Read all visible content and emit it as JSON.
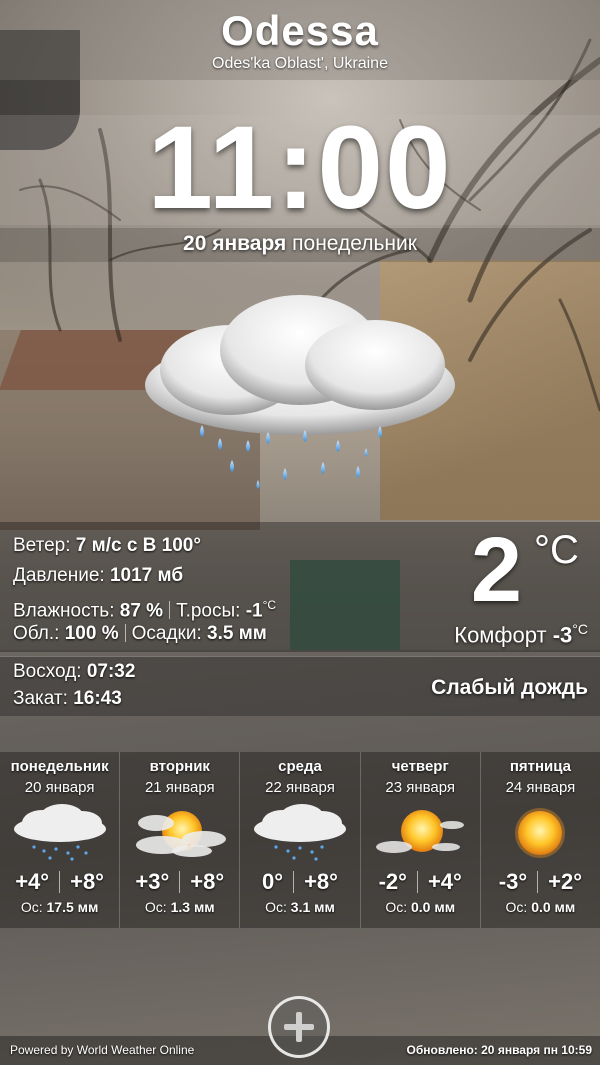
{
  "location": {
    "city": "Odessa",
    "region": "Odes'ka Oblast', Ukraine"
  },
  "clock": {
    "time": "11:00",
    "date_bold": "20 января",
    "weekday": "понедельник"
  },
  "current": {
    "icon": "rain-cloud-icon",
    "wind_label": "Ветер:",
    "wind_value": "7 м/с с В 100°",
    "pressure_label": "Давление:",
    "pressure_value": "1017 мб",
    "humidity_label": "Влажность:",
    "humidity_value": "87 %",
    "dewpoint_label": "Т.росы:",
    "dewpoint_value": "-1",
    "dewpoint_unit": "°C",
    "clouds_label": "Обл.:",
    "clouds_value": "100 %",
    "precip_label": "Осадки:",
    "precip_value": "3.5 мм",
    "temperature": "2",
    "temperature_unit": "°C",
    "feels_label": "Комфорт",
    "feels_value": "-3",
    "feels_unit": "°C",
    "sunrise_label": "Восход:",
    "sunrise_value": "07:32",
    "sunset_label": "Закат:",
    "sunset_value": "16:43",
    "condition": "Слабый дождь"
  },
  "forecast": [
    {
      "day": "понедельник",
      "date": "20 января",
      "icon": "rain-cloud-icon",
      "low": "+4°",
      "high": "+8°",
      "precip_label": "Ос:",
      "precip": "17.5 мм"
    },
    {
      "day": "вторник",
      "date": "21 января",
      "icon": "partly-cloudy-icon",
      "low": "+3°",
      "high": "+8°",
      "precip_label": "Ос:",
      "precip": "1.3 мм"
    },
    {
      "day": "среда",
      "date": "22 января",
      "icon": "rain-cloud-icon",
      "low": "0°",
      "high": "+8°",
      "precip_label": "Ос:",
      "precip": "3.1 мм"
    },
    {
      "day": "четверг",
      "date": "23 января",
      "icon": "sun-behind-cloud-icon",
      "low": "-2°",
      "high": "+4°",
      "precip_label": "Ос:",
      "precip": "0.0 мм"
    },
    {
      "day": "пятница",
      "date": "24 января",
      "icon": "sun-icon",
      "low": "-3°",
      "high": "+2°",
      "precip_label": "Ос:",
      "precip": "0.0 мм"
    }
  ],
  "footer": {
    "powered_by": "Powered by World Weather Online",
    "updated": "Обновлено: 20 января пн 10:59",
    "add_icon": "plus-icon"
  },
  "colors": {
    "text": "#ffffff",
    "panel": "#1a1a1a",
    "sun": "#f6a21a"
  }
}
